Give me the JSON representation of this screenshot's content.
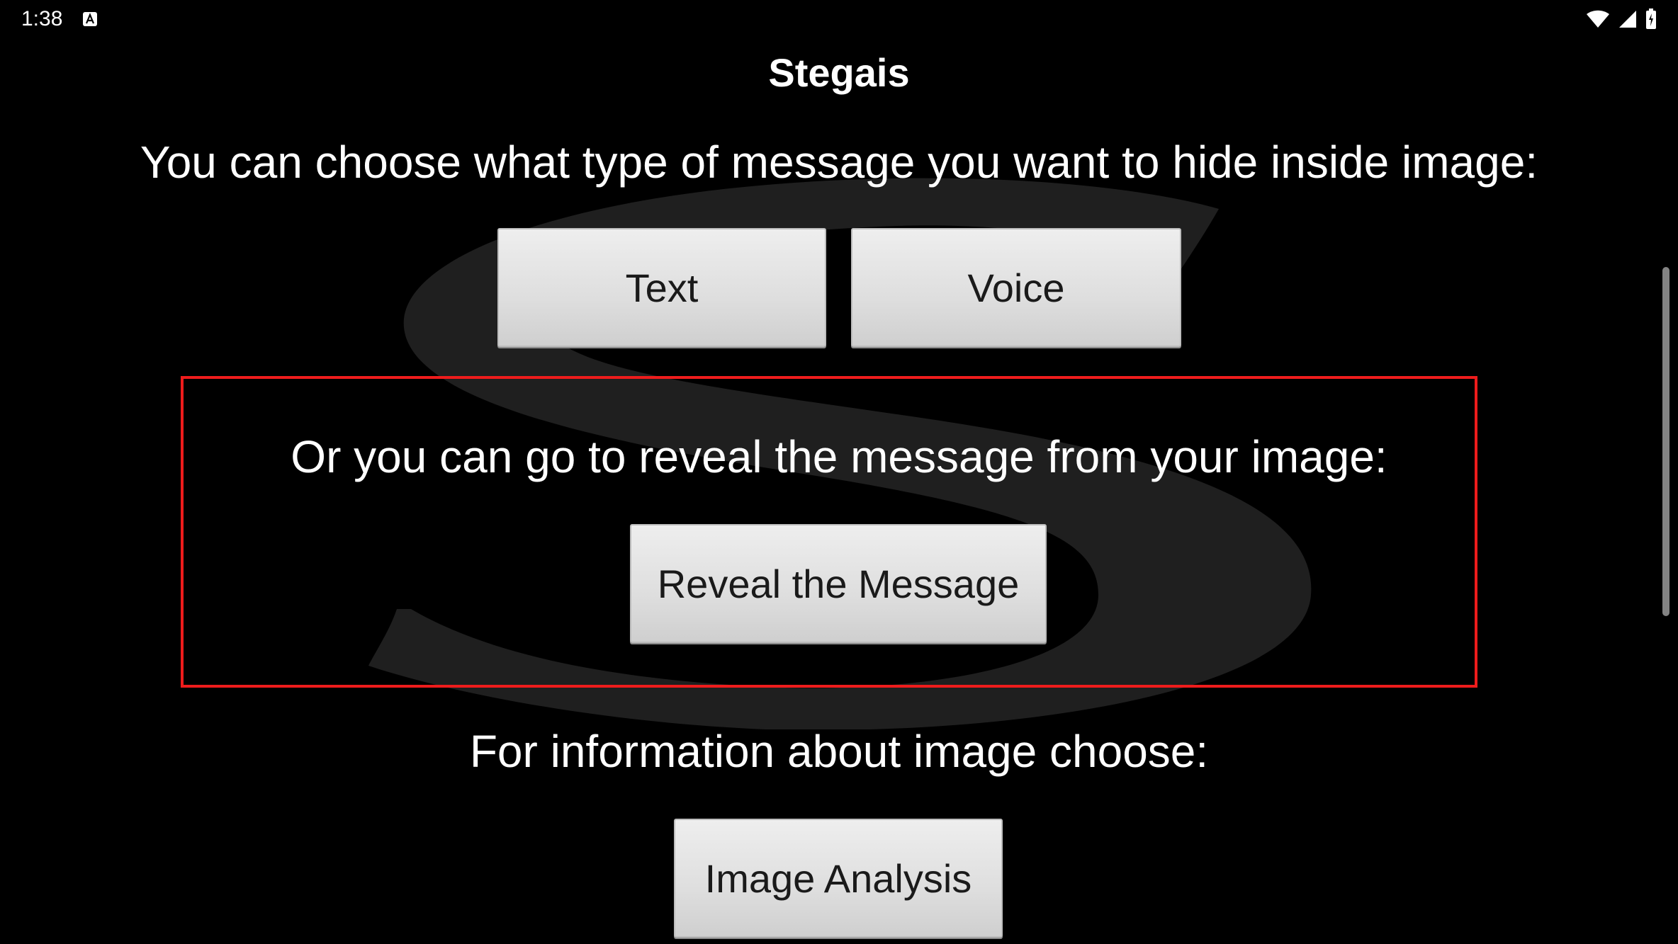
{
  "status_bar": {
    "time": "1:38",
    "notification_icon": "a-notification-icon",
    "wifi_icon": "wifi-icon",
    "signal_icon": "cell-signal-icon",
    "battery_icon": "battery-icon"
  },
  "app": {
    "title": "Stegais"
  },
  "main": {
    "hide_prompt": "You can choose what type of message you want to hide inside image:",
    "text_button": "Text",
    "voice_button": "Voice",
    "reveal_prompt": "Or you can go to reveal the message from your image:",
    "reveal_button": "Reveal the Message",
    "info_prompt": "For information about image choose:",
    "analysis_button": "Image Analysis"
  },
  "colors": {
    "background": "#000000",
    "button_face": "#dedede",
    "highlight": "#ee1c1c",
    "watermark": "#1f1f1f"
  }
}
